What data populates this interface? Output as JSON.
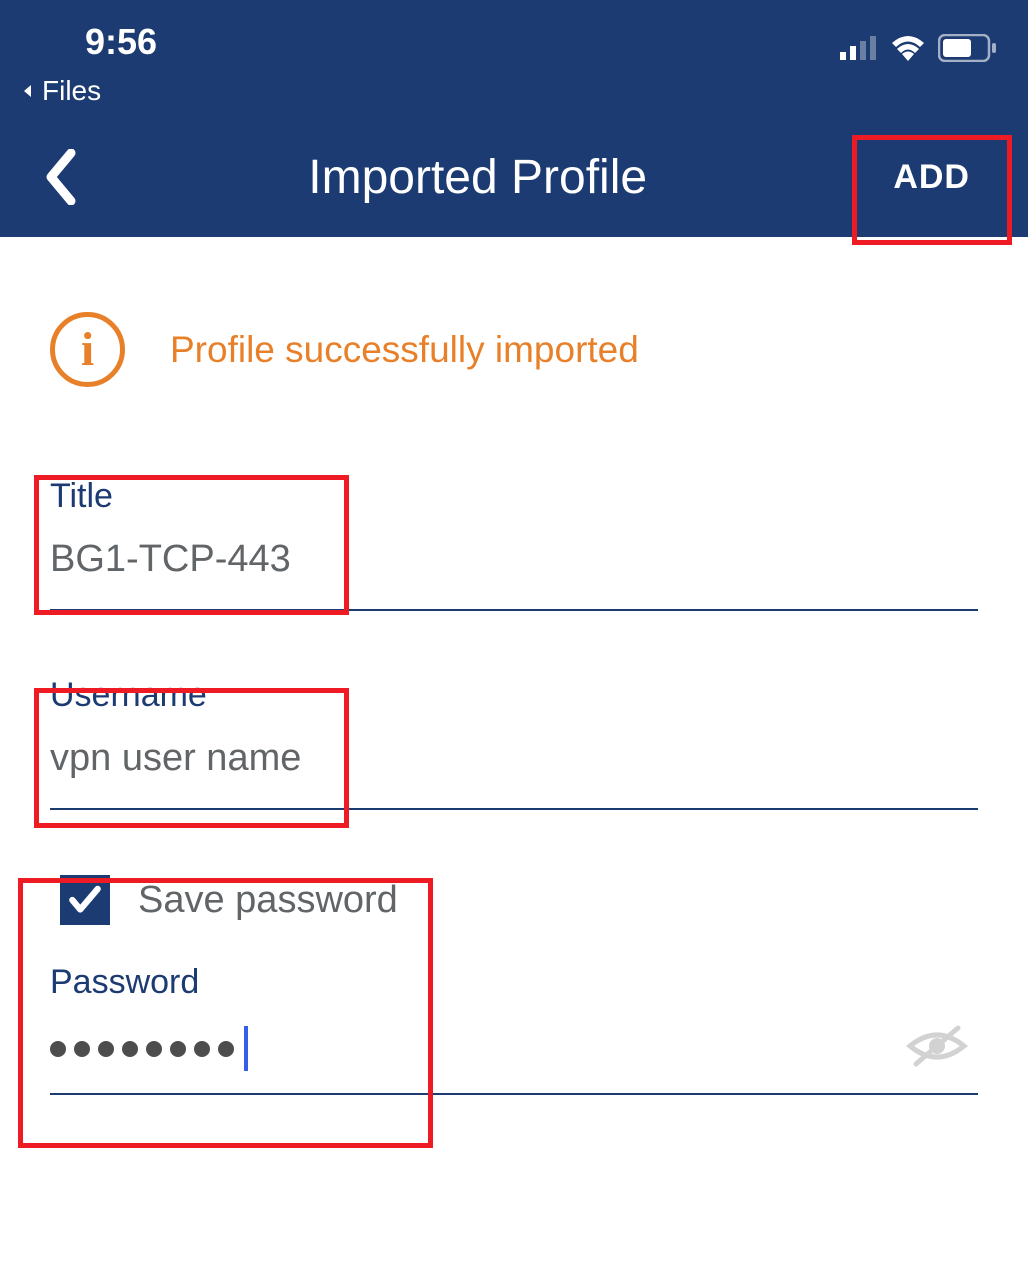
{
  "status": {
    "time": "9:56",
    "back_app_label": "Files"
  },
  "nav": {
    "title": "Imported Profile",
    "add_button": "ADD"
  },
  "banner": {
    "message": "Profile successfully imported"
  },
  "form": {
    "title_label": "Title",
    "title_value": "BG1-TCP-443",
    "username_label": "Username",
    "username_value": "vpn user name",
    "save_password_label": "Save password",
    "save_password_checked": true,
    "password_label": "Password",
    "password_mask_count": 8
  },
  "colors": {
    "primary": "#1c3b72",
    "accent": "#e8802a",
    "highlight": "#ee1b24"
  }
}
